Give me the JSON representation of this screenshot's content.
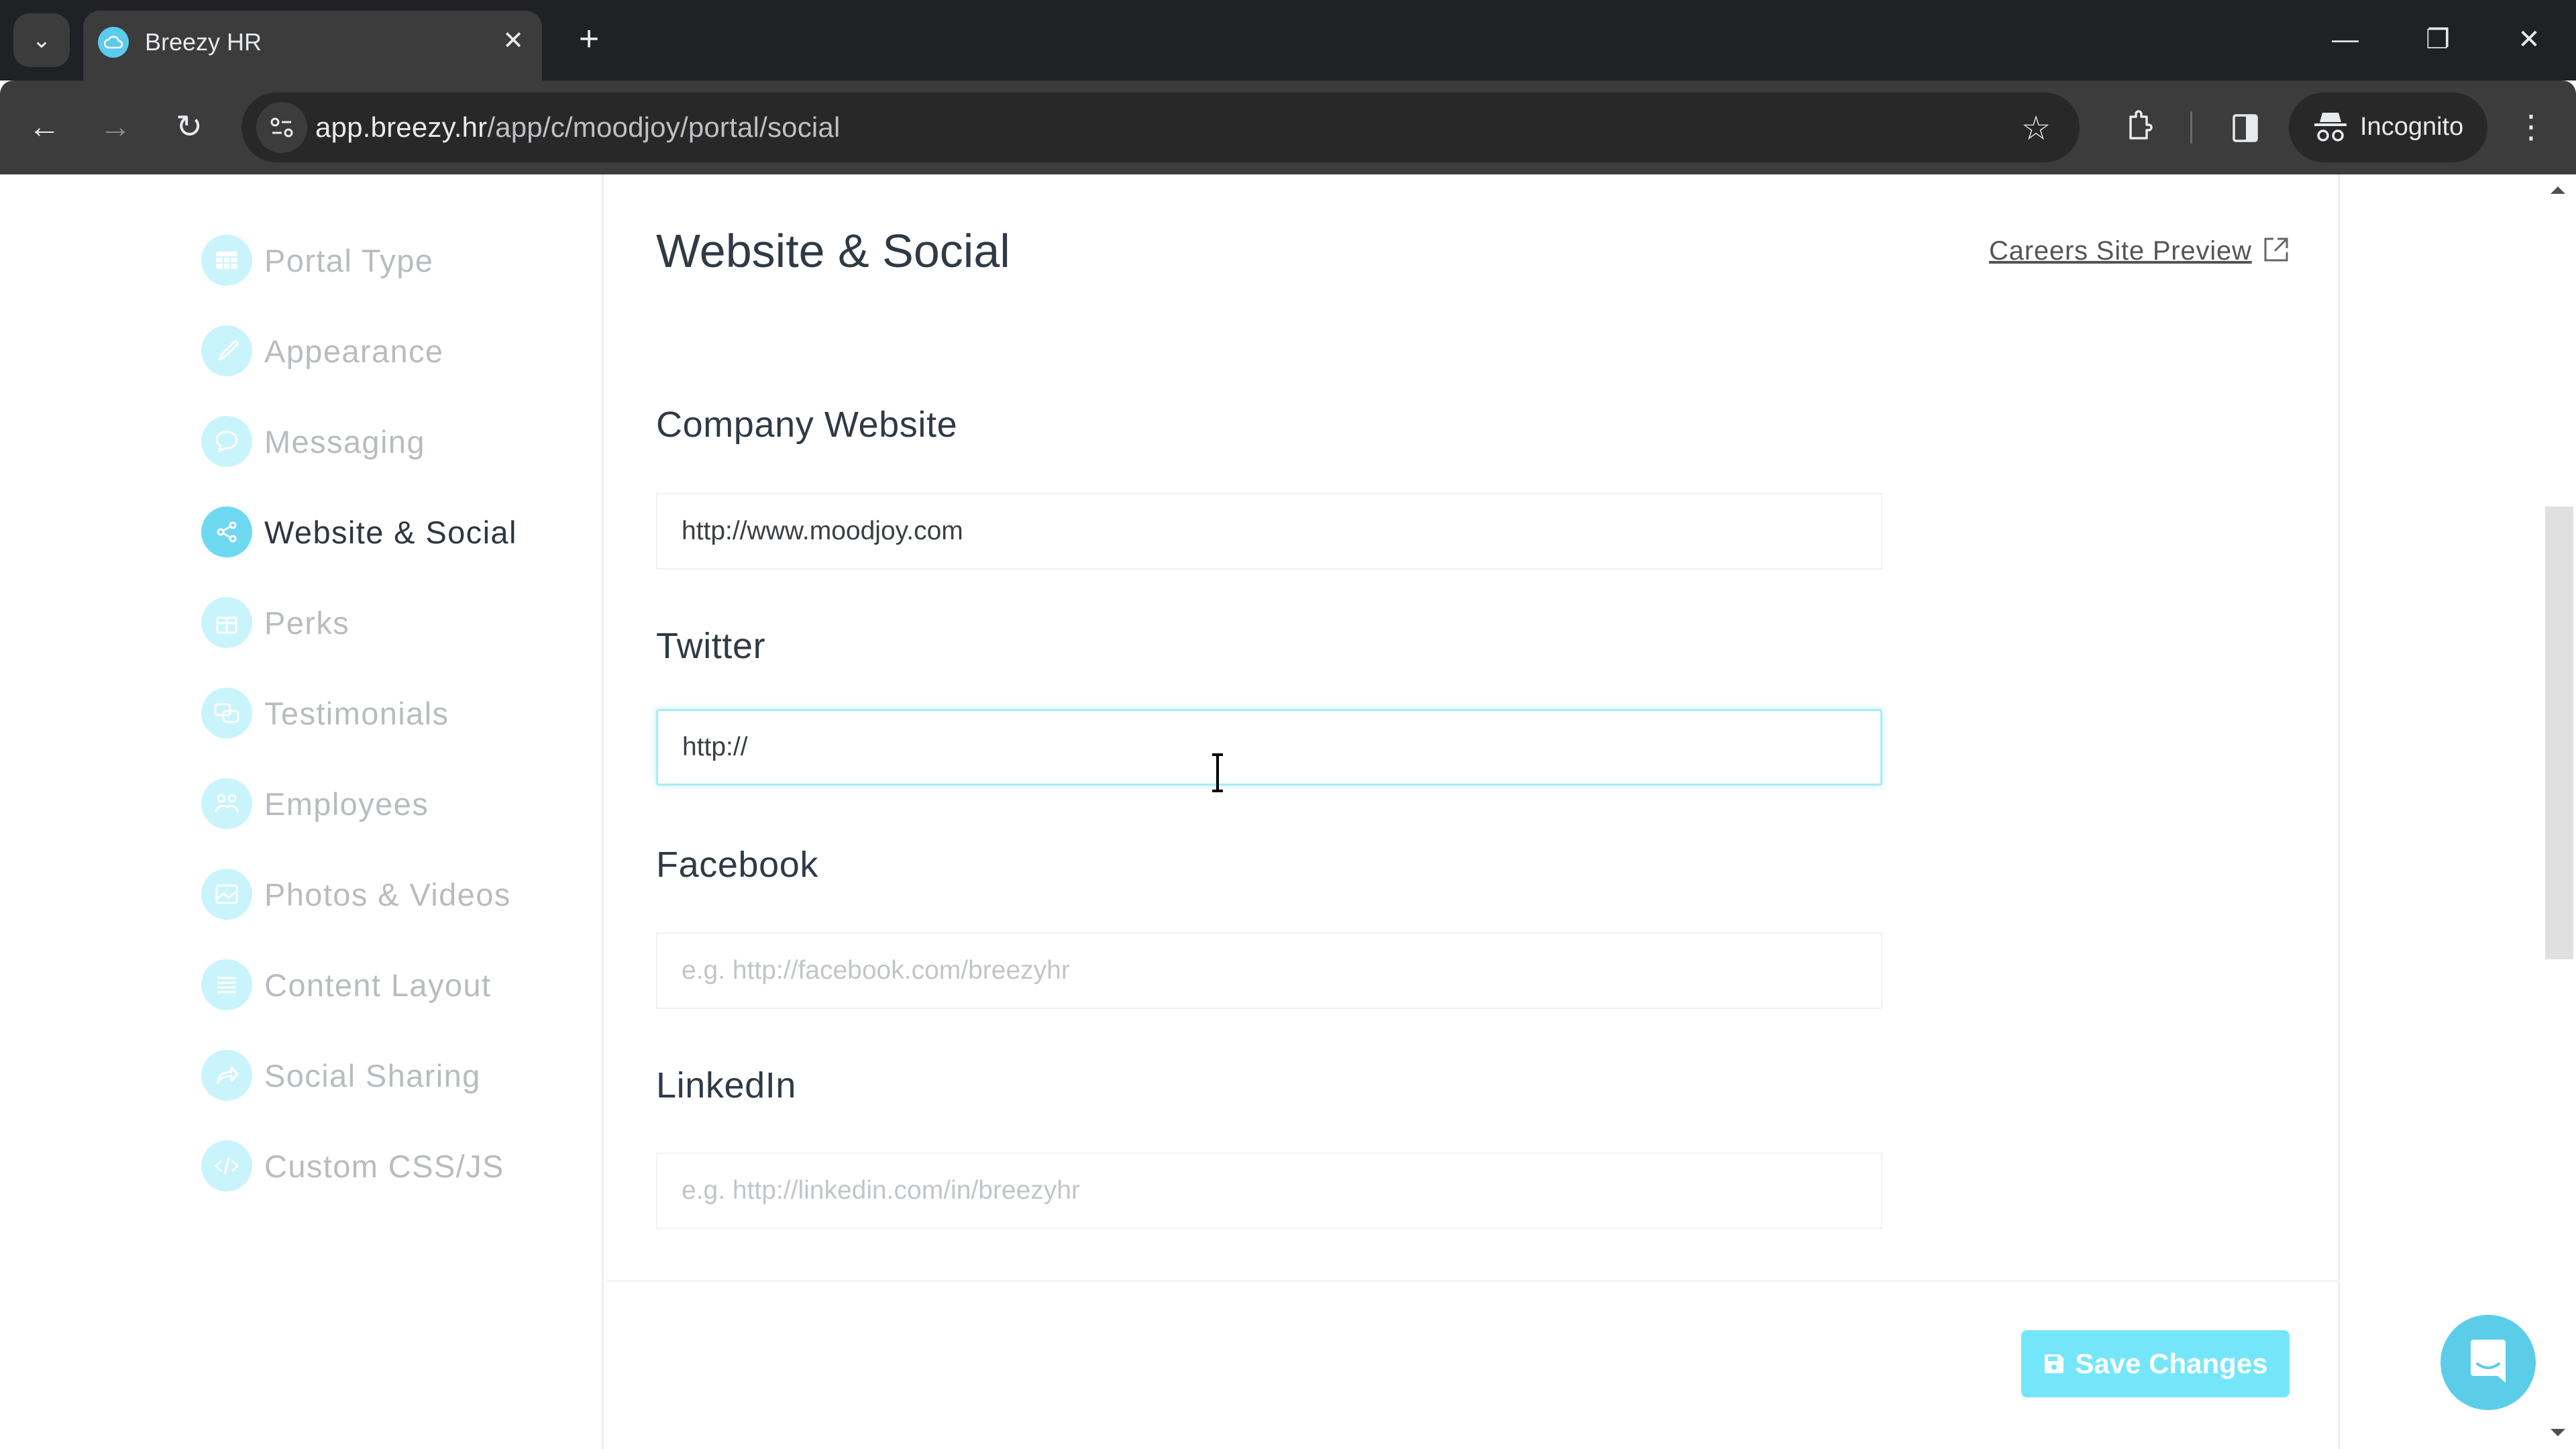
{
  "browser": {
    "tab_title": "Breezy HR",
    "tab_close": "✕",
    "new_tab": "+",
    "url_host": "app.breezy.hr",
    "url_path": "/app/c/moodjoy/portal/social",
    "incognito_label": "Incognito",
    "window_controls": {
      "minimize": "—",
      "restore": "❐",
      "close": "✕"
    },
    "nav": {
      "back": "←",
      "forward": "→",
      "reload": "↻"
    }
  },
  "sidebar": {
    "items": [
      {
        "label": "Portal Type",
        "icon": "grid-icon",
        "active": false
      },
      {
        "label": "Appearance",
        "icon": "brush-icon",
        "active": false
      },
      {
        "label": "Messaging",
        "icon": "chat-bubble-icon",
        "active": false
      },
      {
        "label": "Website & Social",
        "icon": "share-icon",
        "active": true
      },
      {
        "label": "Perks",
        "icon": "gift-icon",
        "active": false
      },
      {
        "label": "Testimonials",
        "icon": "comments-icon",
        "active": false
      },
      {
        "label": "Employees",
        "icon": "users-icon",
        "active": false
      },
      {
        "label": "Photos & Videos",
        "icon": "image-icon",
        "active": false
      },
      {
        "label": "Content Layout",
        "icon": "list-icon",
        "active": false
      },
      {
        "label": "Social Sharing",
        "icon": "share-arrow-icon",
        "active": false
      },
      {
        "label": "Custom CSS/JS",
        "icon": "code-icon",
        "active": false
      }
    ]
  },
  "main": {
    "title": "Website & Social",
    "preview_link": "Careers Site Preview",
    "fields": [
      {
        "label": "Company Website",
        "value": "http://www.moodjoy.com",
        "placeholder": ""
      },
      {
        "label": "Twitter",
        "value": "http://",
        "placeholder": "",
        "focused": true
      },
      {
        "label": "Facebook",
        "value": "",
        "placeholder": "e.g. http://facebook.com/breezyhr"
      },
      {
        "label": "LinkedIn",
        "value": "",
        "placeholder": "e.g. http://linkedin.com/in/breezyhr"
      }
    ],
    "save_label": "Save Changes"
  },
  "colors": {
    "accent": "#6fd9f2",
    "accent_light": "#c9f4fb",
    "save_button": "#75e6fa",
    "chat_button": "#5bcde9"
  }
}
